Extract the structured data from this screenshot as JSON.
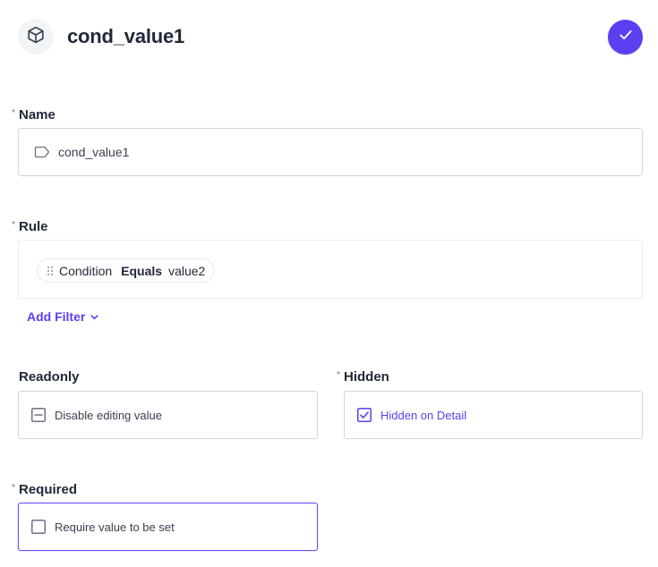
{
  "header": {
    "title": "cond_value1",
    "icon": "cube-icon",
    "confirm_icon": "check-icon"
  },
  "name_field": {
    "label": "Name",
    "required_marker": "*",
    "value": "cond_value1",
    "icon": "tag-icon"
  },
  "rule_field": {
    "label": "Rule",
    "required_marker": "*",
    "chips": [
      {
        "field": "Condition",
        "operator": "Equals",
        "value": "value2"
      }
    ],
    "add_filter_label": "Add Filter"
  },
  "readonly_field": {
    "label": "Readonly",
    "option_label": "Disable editing value",
    "state": "indeterminate"
  },
  "hidden_field": {
    "label": "Hidden",
    "required_marker": "*",
    "option_label": "Hidden on Detail",
    "state": "checked"
  },
  "required_field": {
    "label": "Required",
    "required_marker": "*",
    "option_label": "Require value to be set",
    "state": "unchecked"
  },
  "colors": {
    "accent": "#5b3ff0",
    "border": "#d1d5db",
    "text": "#1f2937"
  }
}
